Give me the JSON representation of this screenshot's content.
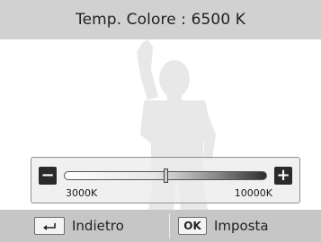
{
  "header": {
    "title": "Temp. Colore : 6500 K"
  },
  "slider": {
    "min_label": "3000K",
    "max_label": "10000K",
    "min_value": 3000,
    "max_value": 10000,
    "current_value": 6500,
    "minus_symbol": "−",
    "plus_symbol": "+"
  },
  "footer": {
    "back_label": "Indietro",
    "ok_key": "OK",
    "ok_label": "Imposta",
    "back_icon": "return-arrow-icon"
  },
  "colors": {
    "header_bg": "#d1d1d1",
    "footer_bg": "#c6c6c6",
    "silhouette": "#e8e8e8"
  }
}
